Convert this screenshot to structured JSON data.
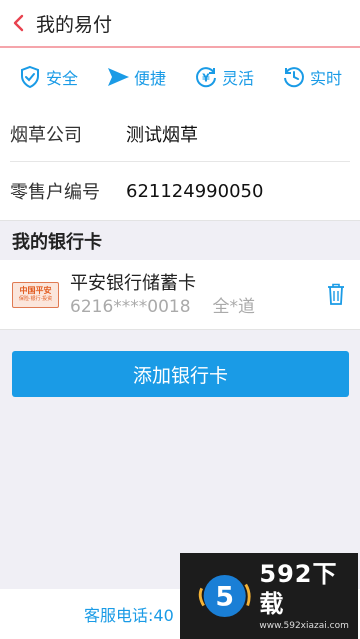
{
  "header": {
    "title": "我的易付"
  },
  "features": [
    {
      "label": "安全",
      "icon": "shield-check-icon"
    },
    {
      "label": "便捷",
      "icon": "send-arrow-icon"
    },
    {
      "label": "灵活",
      "icon": "yen-refresh-icon"
    },
    {
      "label": "实时",
      "icon": "clock-refresh-icon"
    }
  ],
  "info": {
    "company_label": "烟草公司",
    "company_value": "测试烟草",
    "retailer_label": "零售户编号",
    "retailer_value": "621124990050"
  },
  "cards_section": {
    "title": "我的银行卡"
  },
  "card": {
    "bank_name": "平安银行储蓄卡",
    "number": "6216****0018",
    "holder": "全*道",
    "logo_text": "中国平安",
    "logo_subtext": "保险·银行·投资"
  },
  "add_button": {
    "label": "添加银行卡"
  },
  "footer": {
    "hotline": "客服电话:40"
  },
  "watermark": {
    "title": "592下载",
    "url": "www.592xiazai.com"
  },
  "colors": {
    "accent": "#1a9be6",
    "back_arrow": "#e8424f",
    "header_border": "#f5a5ab"
  }
}
